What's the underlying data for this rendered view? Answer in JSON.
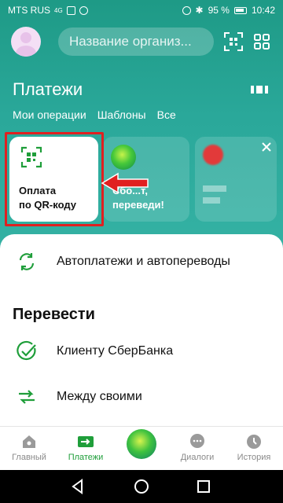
{
  "status_bar": {
    "carrier": "MTS RUS",
    "signal_text": "4G",
    "battery": "95 %",
    "time": "10:42"
  },
  "header": {
    "search_placeholder": "Название организ..."
  },
  "section": {
    "title": "Платежи",
    "tabs": [
      "Мои операции",
      "Шаблоны",
      "Все"
    ]
  },
  "cards": {
    "qr": {
      "line1": "Оплата",
      "line2": "по QR-коду"
    },
    "promo": {
      "line1": "Сбо...т,",
      "line2": "переведи!"
    }
  },
  "list": {
    "autopay": "Автоплатежи и автопереводы",
    "transfer_title": "Перевести",
    "to_client": "Клиенту СберБанка",
    "between_own": "Между своими"
  },
  "bottom_nav": {
    "items": [
      "Главный",
      "Платежи",
      "Диалоги",
      "История"
    ],
    "active": "Платежи"
  },
  "colors": {
    "accent_green": "#1f9e3a",
    "teal_bg": "#2aa89a",
    "highlight_red": "#e02020"
  }
}
